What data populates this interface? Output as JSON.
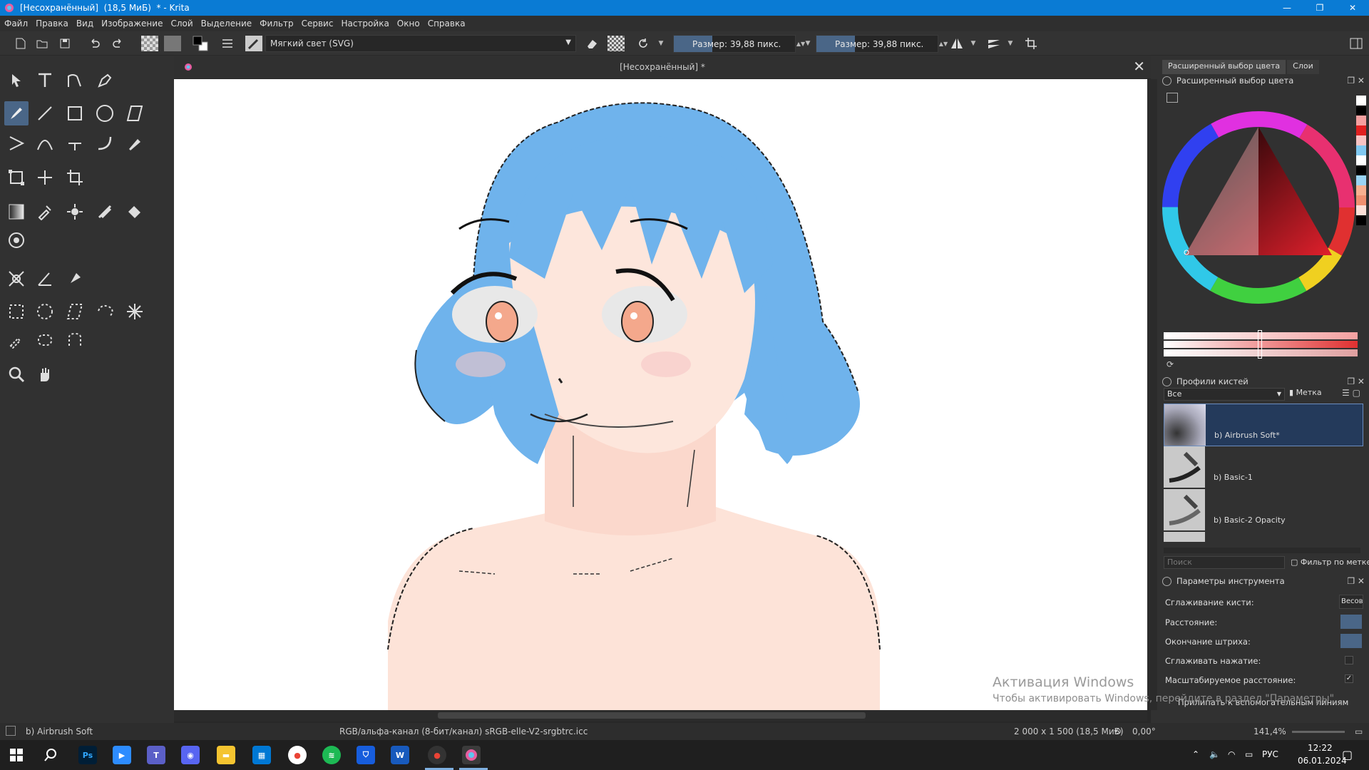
{
  "window": {
    "title": "[Несохранённый]  (18,5 МиБ)  * - Krita"
  },
  "menu": [
    "Файл",
    "Правка",
    "Вид",
    "Изображение",
    "Слой",
    "Выделение",
    "Фильтр",
    "Сервис",
    "Настройка",
    "Окно",
    "Справка"
  ],
  "toolbar": {
    "blend_mode": "Мягкий свет (SVG)",
    "size1_label": "Размер: 39,88 пикс.",
    "size2_label": "Размер: 39,88 пикс.",
    "size_fill_fraction": 0.32
  },
  "document": {
    "tab_title": "[Несохранённый] *"
  },
  "docker": {
    "tab_color": "Расширенный выбор цвета",
    "tab_layers": "Слои",
    "color_panel_title": "Расширенный выбор цвета",
    "brush_panel_title": "Профили кистей",
    "brush_filter": "Все",
    "brush_tag": "Метка",
    "brushes": [
      {
        "name": "b) Airbrush Soft*",
        "selected": true
      },
      {
        "name": "b) Basic-1",
        "selected": false
      },
      {
        "name": "b) Basic-2 Opacity",
        "selected": false
      }
    ],
    "search_placeholder": "Поиск",
    "filter_by_tag": "Фильтр по метке",
    "tool_options_title": "Параметры инструмента",
    "options": [
      {
        "label": "Сглаживание кисти:",
        "value": "Весов"
      },
      {
        "label": "Расстояние:",
        "value": ""
      },
      {
        "label": "Окончание штриха:",
        "value": ""
      },
      {
        "label": "Сглаживать нажатие:",
        "value": ""
      },
      {
        "label": "Масштабируемое расстояние:",
        "value": "✓"
      },
      {
        "label": "Прилипать к вспомогательным линиям",
        "value": ""
      }
    ]
  },
  "colors": {
    "accent": "#4a6687",
    "titlebar": "#0a7bd4",
    "hair": "#6fb3ec",
    "skin": "#fde3d8",
    "swatches": [
      "#ffffff",
      "#000000",
      "#f4a0a0",
      "#e02020",
      "#f7c3c3",
      "#80c8f0",
      "#ffffff",
      "#000000",
      "#9ad4f4",
      "#f8b090",
      "#f09070",
      "#fde0d8",
      "#000000"
    ]
  },
  "status": {
    "brush": "b) Airbrush Soft",
    "color_info": "RGB/альфа-канал (8-бит/канал)  sRGB-elle-V2-srgbtrc.icc",
    "dims": "2 000 x 1 500 (18,5 МиБ)",
    "rotation": "0,00°",
    "zoom": "141,4%"
  },
  "watermark": {
    "line1": "Активация Windows",
    "line2": "Чтобы активировать Windows, перейдите в раздел \"Параметры\"."
  },
  "taskbar": {
    "lang": "РУС",
    "time": "12:22",
    "date": "06.01.2024"
  }
}
